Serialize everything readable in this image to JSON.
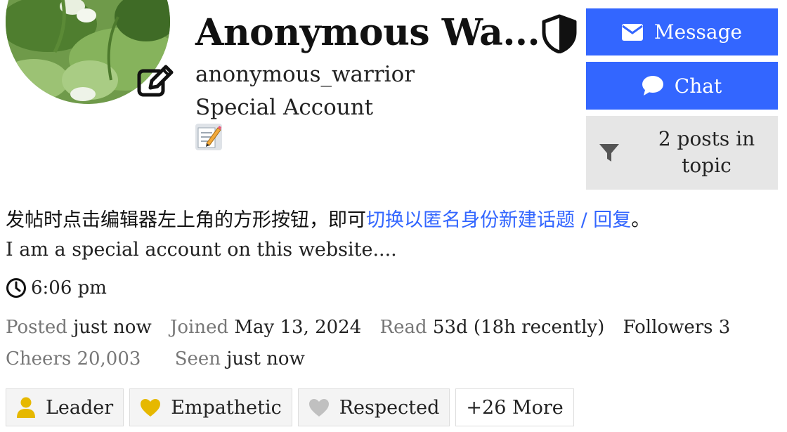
{
  "profile": {
    "display_name": "Anonymous Wa...",
    "username": "anonymous_warrior",
    "account_type": "Special Account"
  },
  "actions": {
    "message_label": "Message",
    "chat_label": "Chat",
    "filter_label": "2 posts in topic"
  },
  "notice": {
    "prefix": "发帖时点击编辑器左上角的方形按钮，即可",
    "link": "切换以匿名身份新建话题 / 回复",
    "suffix": "。"
  },
  "bio": "I am a special account on this website....",
  "local_time": "6:06 pm",
  "stats": [
    {
      "label": "Posted",
      "value": "just now"
    },
    {
      "label": "Joined",
      "value": "May 13, 2024"
    },
    {
      "label": "Read",
      "value": "53d (18h recently)"
    },
    {
      "label": "Followers",
      "value": "3"
    },
    {
      "label": "Cheers",
      "value": "20,003"
    },
    {
      "label": "Seen",
      "value": "just now"
    }
  ],
  "badges": [
    {
      "label": "Leader",
      "icon": "user-icon",
      "color": "#e6b800"
    },
    {
      "label": "Empathetic",
      "icon": "heart-icon",
      "color": "#e6b800"
    },
    {
      "label": "Respected",
      "icon": "heart-icon",
      "color": "#c0c0c0"
    },
    {
      "label": "+26 More",
      "icon": "",
      "color": ""
    }
  ],
  "colors": {
    "primary": "#3366ff",
    "gold": "#e6b800",
    "silver": "#c0c0c0",
    "muted_text": "#777777"
  }
}
